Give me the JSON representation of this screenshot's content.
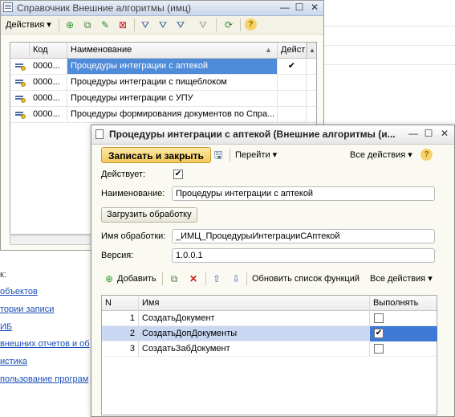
{
  "background": {
    "section_label": "к:",
    "links": [
      "объектов",
      "тории записи",
      "ИБ",
      "внешних отчетов и об",
      "истика",
      "пользование програм"
    ]
  },
  "window1": {
    "title": "Справочник Внешние алгоритмы (имц)",
    "buttons": {
      "minimize": "—",
      "maximize": "☐",
      "close": "✕"
    },
    "toolbar": {
      "actions_label": "Действия ▾"
    },
    "columns": {
      "code": "Код",
      "name": "Наименование",
      "active": "Дейст"
    },
    "rows": [
      {
        "code": "0000...",
        "name": "Процедуры интеграции с аптекой",
        "active": "✔"
      },
      {
        "code": "0000...",
        "name": "Процедуры интеграции с пищеблоком",
        "active": ""
      },
      {
        "code": "0000...",
        "name": "Процедуры интеграции с УПУ",
        "active": ""
      },
      {
        "code": "0000...",
        "name": "Процедуры формирования документов по Спра...",
        "active": ""
      }
    ]
  },
  "window2": {
    "title": "Процедуры интеграции с аптекой (Внешние алгоритмы (и...",
    "buttons": {
      "minimize": "—",
      "maximize": "☐",
      "close": "✕"
    },
    "commandbar": {
      "save_close": "Записать и закрыть",
      "goto": "Перейти ▾",
      "all_actions": "Все действия ▾",
      "help": "?"
    },
    "form": {
      "active_label": "Действует:",
      "active_checked": "✔",
      "name_label": "Наименование:",
      "name_value": "Процедуры интеграции с аптекой",
      "load_button": "Загрузить обработку",
      "processing_label": "Имя обработки:",
      "processing_value": "_ИМЦ_ПроцедурыИнтеграцииСАптекой",
      "version_label": "Версия:",
      "version_value": "1.0.0.1"
    },
    "table_toolbar": {
      "add": "Добавить",
      "refresh_functions": "Обновить список функций",
      "all_actions": "Все действия ▾"
    },
    "table": {
      "columns": {
        "n": "N",
        "name": "Имя",
        "execute": "Выполнять"
      },
      "rows": [
        {
          "n": "1",
          "name": "СоздатьДокумент",
          "checked": ""
        },
        {
          "n": "2",
          "name": "СоздатьДопДокументы",
          "checked": "✔"
        },
        {
          "n": "3",
          "name": "СоздатьЗабДокумент",
          "checked": ""
        }
      ]
    }
  }
}
